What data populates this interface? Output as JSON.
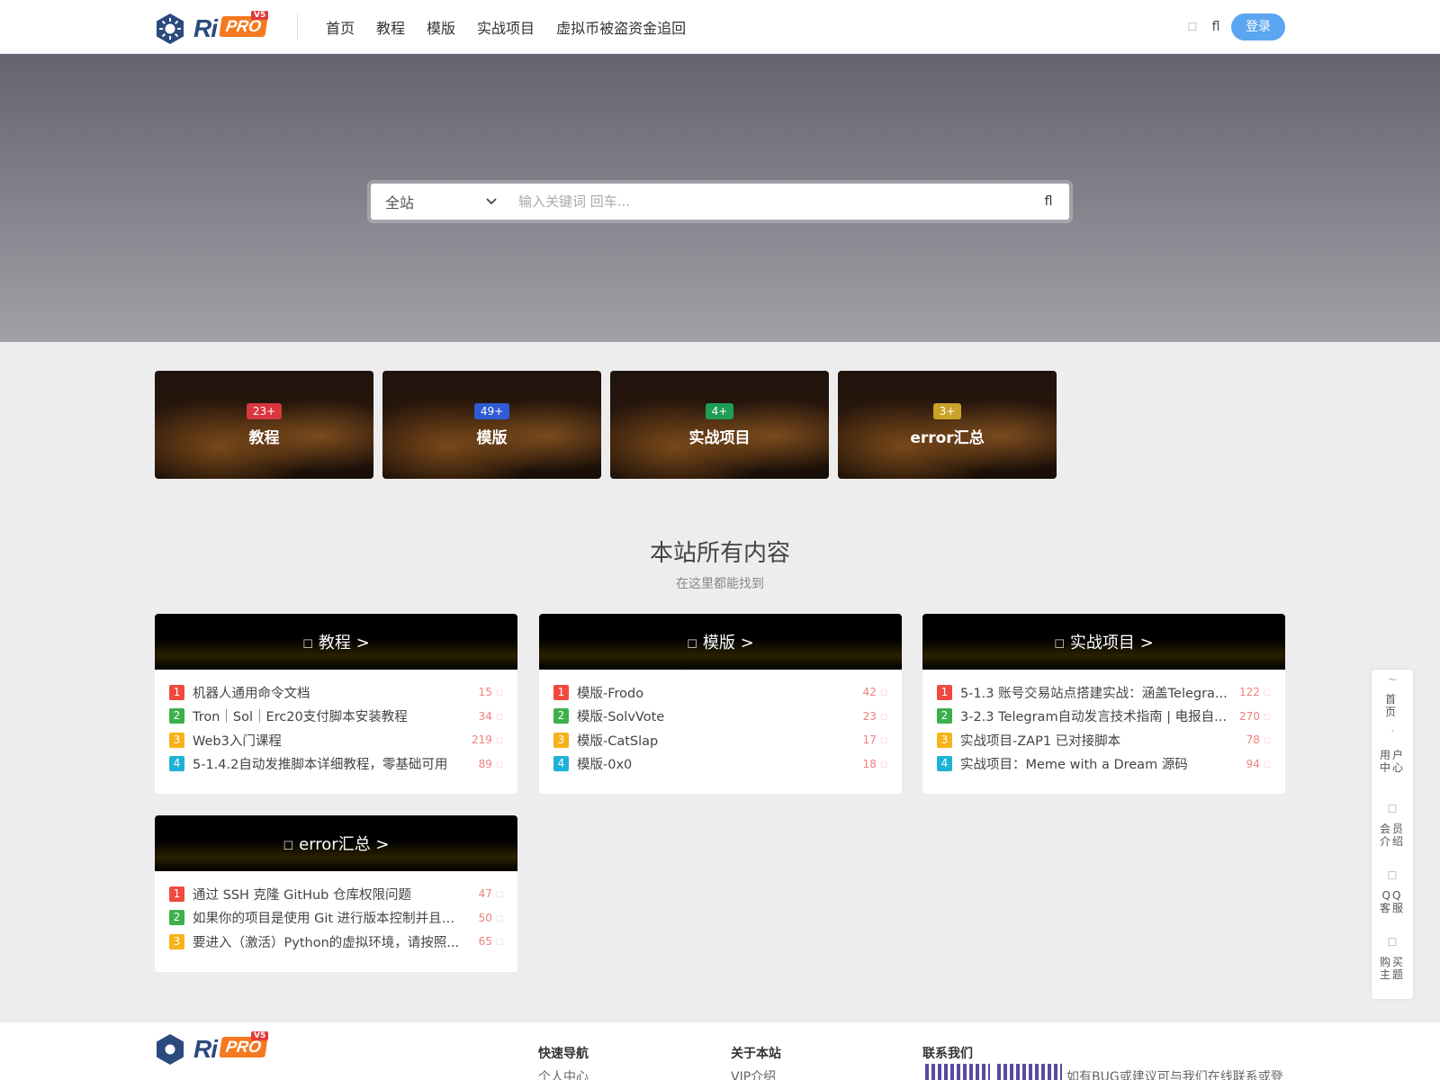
{
  "header": {
    "logo": {
      "ri": "Ri",
      "pro": "PRO",
      "v5": "V5"
    },
    "nav": [
      "首页",
      "教程",
      "模版",
      "实战项目",
      "虚拟币被盗资金追回"
    ],
    "login": "登录",
    "icons": {
      "mode": "moon-icon",
      "search": "search-icon"
    }
  },
  "search": {
    "scope": "全站",
    "placeholder": "输入关键词 回车..."
  },
  "categories": [
    {
      "count": "23+",
      "name": "教程",
      "color": "#d9363e"
    },
    {
      "count": "49+",
      "name": "模版",
      "color": "#2f5bd4"
    },
    {
      "count": "4+",
      "name": "实战项目",
      "color": "#1f9d55"
    },
    {
      "count": "3+",
      "name": "error汇总",
      "color": "#c9a227"
    }
  ],
  "section": {
    "title": "本站所有内容",
    "subtitle": "在这里都能找到"
  },
  "boxes": [
    {
      "title": "教程 >",
      "posts": [
        {
          "title": "机器人通用命令文档",
          "views": "15"
        },
        {
          "title": "Tron｜Sol｜Erc20支付脚本安装教程",
          "views": "34"
        },
        {
          "title": "Web3入门课程",
          "views": "219"
        },
        {
          "title": "5-1.4.2自动发推脚本详细教程，零基础可用",
          "views": "89"
        }
      ]
    },
    {
      "title": "模版 >",
      "posts": [
        {
          "title": "模版-Frodo",
          "views": "42"
        },
        {
          "title": "模版-SolvVote",
          "views": "23"
        },
        {
          "title": "模版-CatSlap",
          "views": "17"
        },
        {
          "title": "模版-0x0",
          "views": "18"
        }
      ]
    },
    {
      "title": "实战项目 >",
      "posts": [
        {
          "title": "5-1.3 账号交易站点搭建实战：涵盖Telegra...",
          "views": "122"
        },
        {
          "title": "3-2.3 Telegram自动发言技术指南 | 电报自...",
          "views": "270"
        },
        {
          "title": "实战项目-ZAP1 已对接脚本",
          "views": "78"
        },
        {
          "title": "实战项目：Meme with a Dream 源码",
          "views": "94"
        }
      ]
    },
    {
      "title": "error汇总 >",
      "posts": [
        {
          "title": "通过 SSH 克隆 GitHub 仓库权限问题",
          "views": "47"
        },
        {
          "title": "如果你的项目是使用 Git 进行版本控制并且你...",
          "views": "50"
        },
        {
          "title": "要进入（激活）Python的虚拟环境，请按照...",
          "views": "65"
        }
      ]
    }
  ],
  "float_bar": [
    {
      "label": "首页",
      "icon": "home-icon"
    },
    {
      "label": "用户中心",
      "icon": "user-icon"
    },
    {
      "label": "会员介绍",
      "icon": "diamond-icon"
    },
    {
      "label": "QQ客服",
      "icon": "qq-icon"
    },
    {
      "label": "购买主题",
      "icon": "cart-icon"
    }
  ],
  "footer": {
    "cols": [
      {
        "title": "快速导航",
        "item": "个人中心"
      },
      {
        "title": "关于本站",
        "item": "VIP介绍"
      },
      {
        "title": "联系我们",
        "item": "如有BUG或建议可与我们在线联系或登"
      }
    ]
  }
}
